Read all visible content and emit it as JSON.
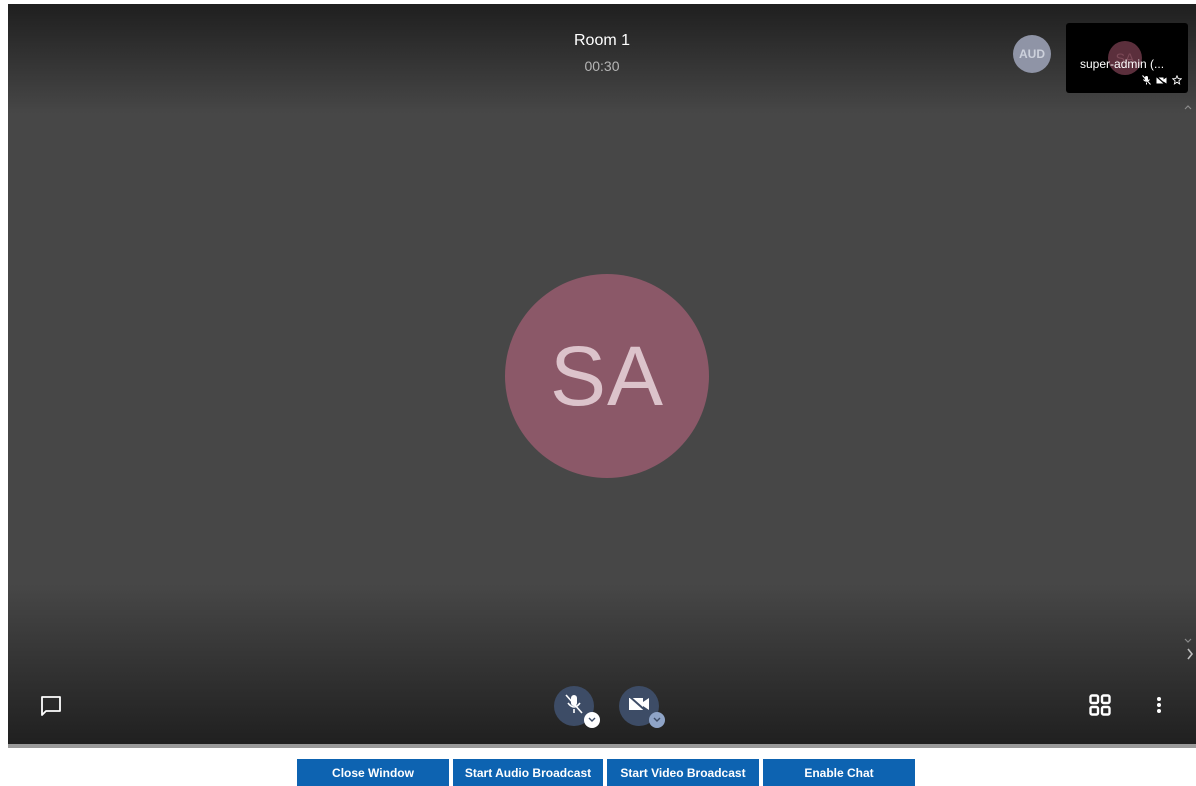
{
  "room": {
    "title": "Room 1",
    "timer": "00:30"
  },
  "audience_avatar": {
    "initials": "AUD"
  },
  "participant_tile": {
    "name": "super-admin (...",
    "avatar_initials": "SA",
    "icons": [
      "mic-off-icon",
      "video-off-icon",
      "star-icon"
    ]
  },
  "main_speaker": {
    "initials": "SA",
    "avatar_color": "#8b5868"
  },
  "controls": {
    "chat_icon": "chat-bubble-icon",
    "mic_icon": "mic-off-icon",
    "video_icon": "video-off-icon",
    "layout_icon": "grid-layout-icon",
    "more_icon": "more-vertical-icon"
  },
  "bottom_bar": {
    "close_window": "Close Window",
    "start_audio": "Start Audio Broadcast",
    "start_video": "Start Video Broadcast",
    "enable_chat": "Enable Chat"
  },
  "colors": {
    "button_blue": "#0d63b1",
    "control_button": "#3d4c66",
    "stage_dark": "#1f1f1f",
    "stage_mid": "#474747"
  }
}
